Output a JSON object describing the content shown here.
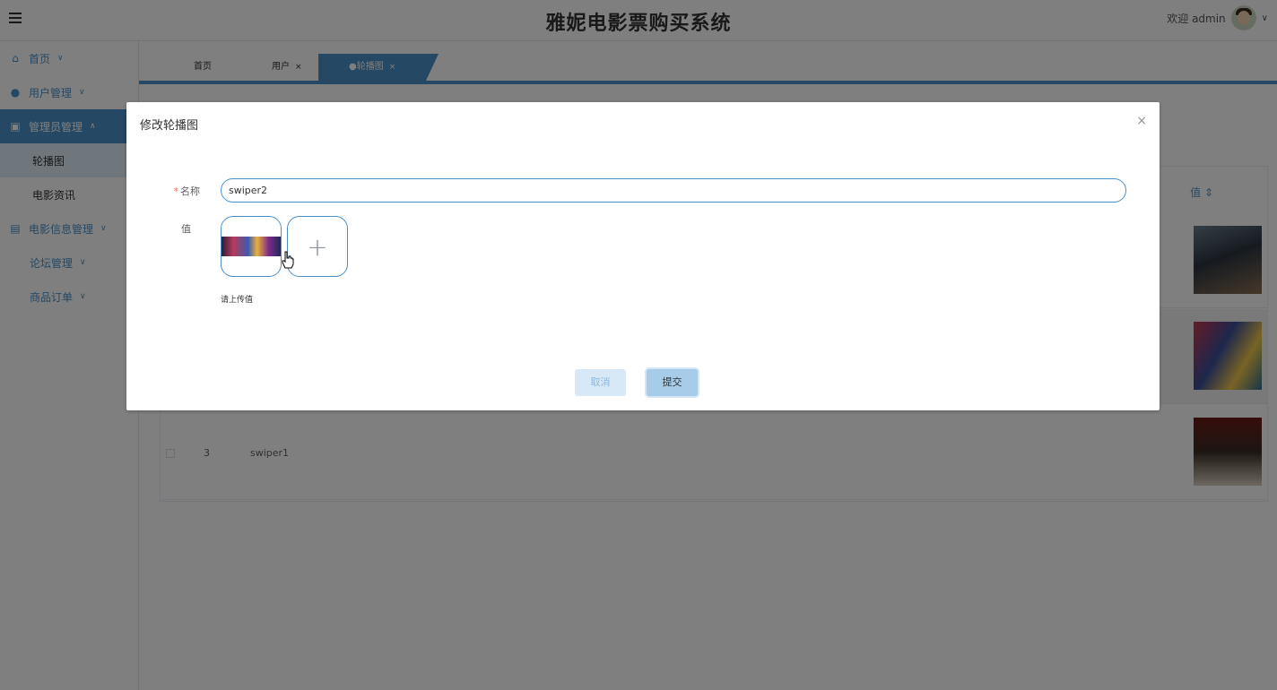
{
  "header": {
    "title": "雅妮电影票购买系统",
    "welcome": "欢迎 admin",
    "caret": "∨"
  },
  "sidebar": {
    "items": [
      {
        "label": "首页",
        "chev": "∨"
      },
      {
        "label": "用户管理",
        "chev": "∨"
      },
      {
        "label": "管理员管理",
        "chev": "∧"
      },
      {
        "label": "轮播图"
      },
      {
        "label": "电影资讯"
      },
      {
        "label": "电影信息管理",
        "chev": "∨"
      },
      {
        "label": "论坛管理",
        "chev": "∨"
      },
      {
        "label": "商品订单",
        "chev": "∨"
      }
    ]
  },
  "tabs": [
    {
      "label": "首页"
    },
    {
      "label": "用户",
      "close": "×"
    },
    {
      "label": "●轮播图",
      "close": "×"
    }
  ],
  "table": {
    "value_header": "值",
    "sort_icon": "⇕",
    "rows": [
      {
        "index": "3",
        "name": "swiper1"
      }
    ]
  },
  "dialog": {
    "title": "修改轮播图",
    "close": "×",
    "name_label": "名称",
    "required_mark": "*",
    "name_value": "swiper2",
    "value_label": "值",
    "plus": "+",
    "upload_hint": "请上传值",
    "cancel": "取消",
    "submit": "提交"
  },
  "colors": {
    "accent": "#4a90c8",
    "required": "#f56c6c"
  }
}
